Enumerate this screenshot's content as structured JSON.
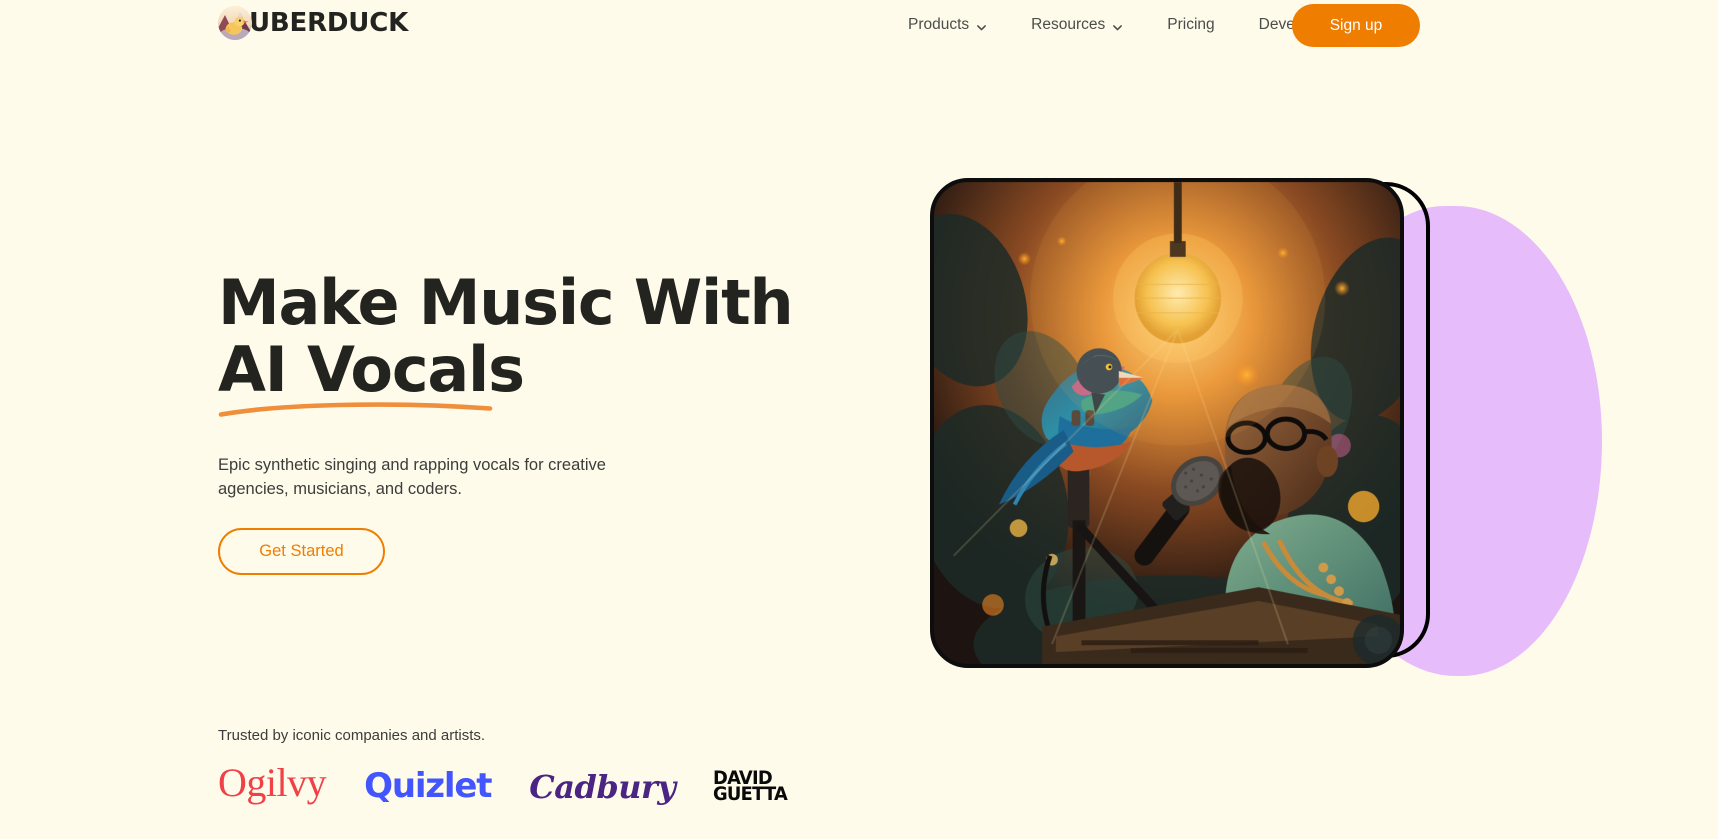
{
  "brand": {
    "name": "UBERDUCK",
    "logo_icon": "duck-logo-icon"
  },
  "nav": {
    "items": [
      {
        "label": "Products",
        "has_dropdown": true,
        "icon": "chevron-down-icon"
      },
      {
        "label": "Resources",
        "has_dropdown": true,
        "icon": "chevron-down-icon"
      },
      {
        "label": "Pricing",
        "has_dropdown": false
      },
      {
        "label": "Developers",
        "has_dropdown": false
      }
    ],
    "signup_label": "Sign up"
  },
  "hero": {
    "title": "Make Music With\nAI Vocals",
    "title_line1": "Make Music With",
    "title_line2": "AI Vocals",
    "subtitle": "Epic synthetic singing and rapping vocals for creative agencies, musicians, and coders.",
    "cta_label": "Get Started",
    "underline_icon": "orange-swoosh-underline-icon"
  },
  "hero_image": {
    "alt": "Bald bearded man with glasses singing into a microphone while a colorful bird perches on the mic stand, glowing lantern and jungle foliage behind",
    "decor_circle_color": "#e7bcfb",
    "decor_outline_color": "#000000"
  },
  "trusted": {
    "label": "Trusted by iconic companies and artists.",
    "logos": [
      {
        "name": "Ogilvy",
        "text": "Ogilvy",
        "color": "#ef4147"
      },
      {
        "name": "Quizlet",
        "text": "Quizlet",
        "color": "#4255ff"
      },
      {
        "name": "Cadbury",
        "text": "Cadbury",
        "color": "#4a2583"
      },
      {
        "name": "David Guetta",
        "text": "DAVID\nGUETTA",
        "color": "#0a0a0a"
      }
    ]
  },
  "theme": {
    "background": "#fffbeb",
    "accent": "#ef7d00",
    "text": "#23241f"
  }
}
